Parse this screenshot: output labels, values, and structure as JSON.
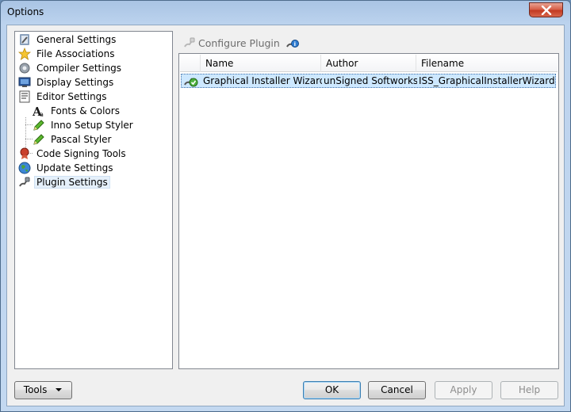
{
  "window": {
    "title": "Options"
  },
  "tree": {
    "items": [
      {
        "label": "General Settings",
        "icon": "hammer-settings-icon"
      },
      {
        "label": "File Associations",
        "icon": "star-icon"
      },
      {
        "label": "Compiler Settings",
        "icon": "gears-icon"
      },
      {
        "label": "Display Settings",
        "icon": "monitor-icon"
      },
      {
        "label": "Editor Settings",
        "icon": "editor-icon"
      },
      {
        "label": "Fonts & Colors",
        "icon": "font-icon"
      },
      {
        "label": "Inno Setup Styler",
        "icon": "pencil-icon"
      },
      {
        "label": "Pascal Styler",
        "icon": "pencil-icon"
      },
      {
        "label": "Code Signing Tools",
        "icon": "seal-icon"
      },
      {
        "label": "Update Settings",
        "icon": "globe-icon"
      },
      {
        "label": "Plugin Settings",
        "icon": "plug-icon"
      }
    ],
    "selected": "Plugin Settings"
  },
  "configure": {
    "label": "Configure Plugin"
  },
  "plugins": {
    "columns": [
      "Name",
      "Author",
      "Filename"
    ],
    "rows": [
      {
        "name": "Graphical Installer Wizard",
        "author": "unSigned Softworks",
        "filename": "ISS_GraphicalInstallerWizard.dll"
      }
    ]
  },
  "buttons": {
    "tools": "Tools",
    "ok": "OK",
    "cancel": "Cancel",
    "apply": "Apply",
    "help": "Help"
  },
  "colors": {
    "title_bar": "#bcd3ee",
    "close_button": "#c9432a",
    "selection": "#cde8ff",
    "default_button_border": "#3c7fb1"
  }
}
